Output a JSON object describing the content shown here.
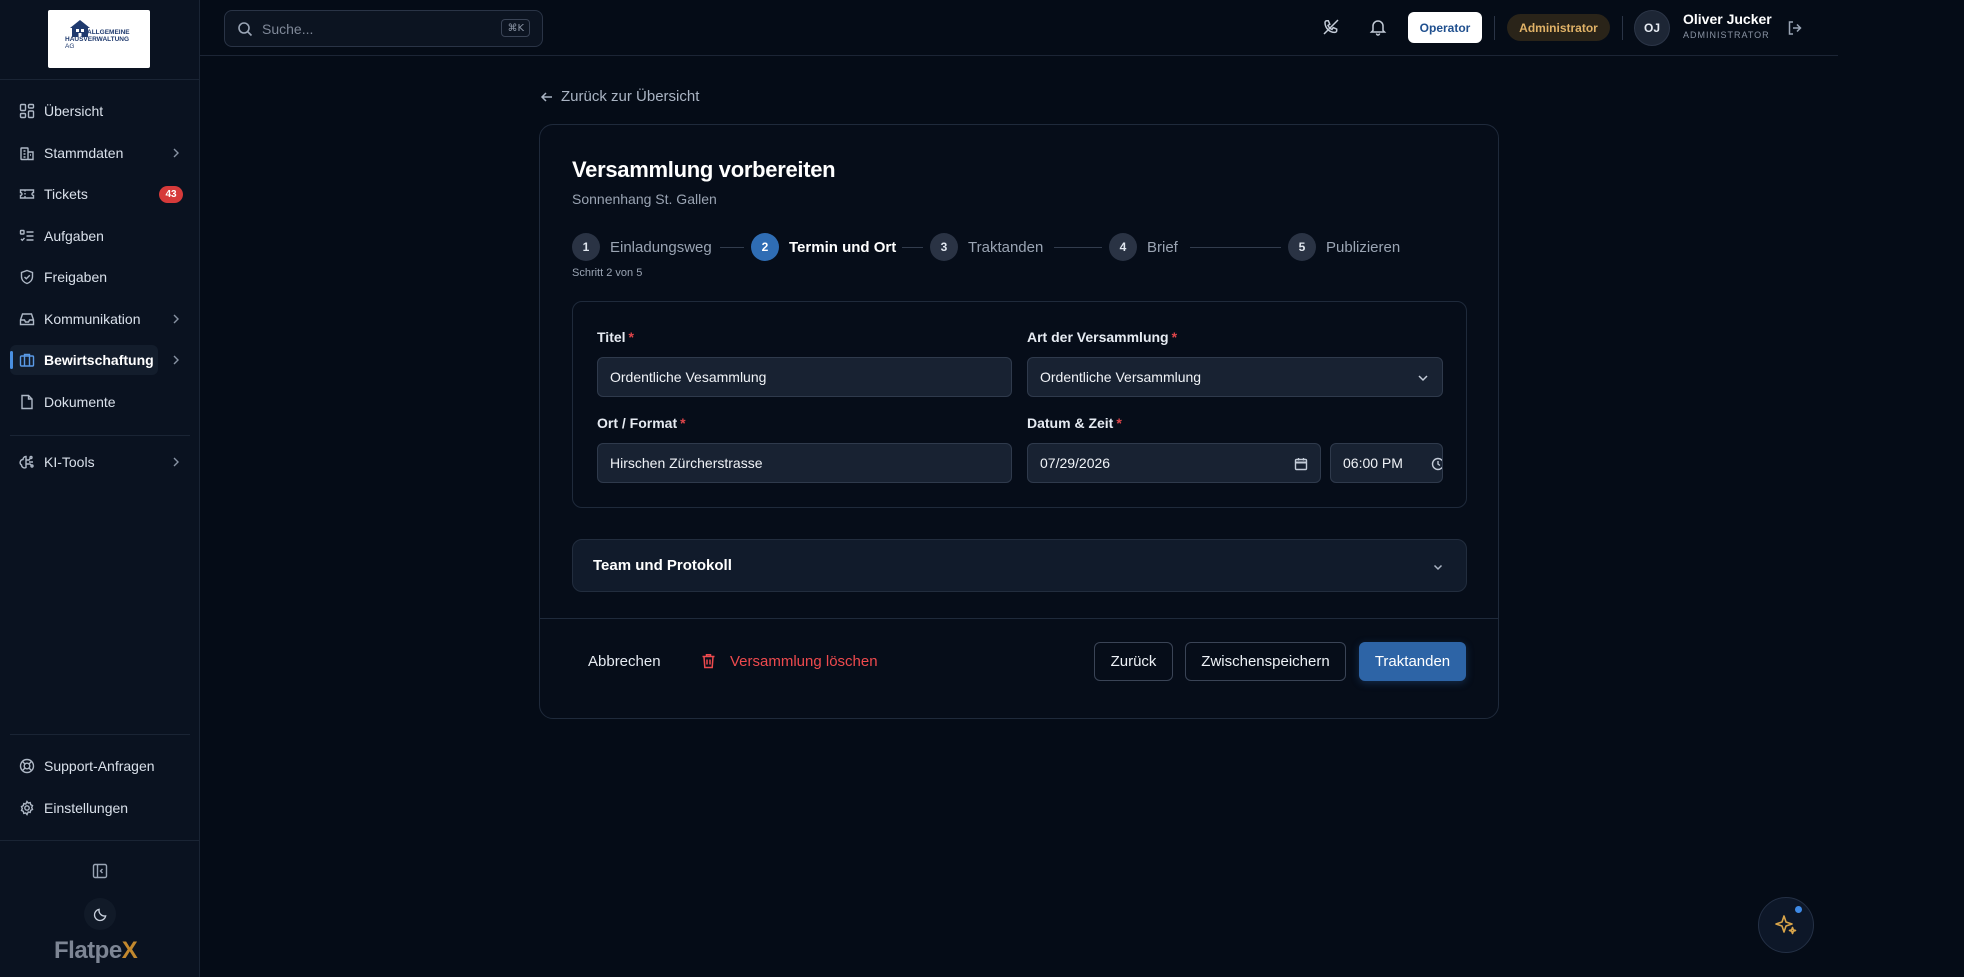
{
  "logo": {
    "line1": "ALLGEMEINE",
    "line2": "HAUSVERWALTUNG",
    "line3": "AG"
  },
  "sidebar": {
    "items": [
      {
        "label": "Übersicht",
        "icon": "dashboard-icon"
      },
      {
        "label": "Stammdaten",
        "icon": "building-icon"
      },
      {
        "label": "Tickets",
        "icon": "ticket-icon",
        "badge": "43"
      },
      {
        "label": "Aufgaben",
        "icon": "task-list-icon"
      },
      {
        "label": "Freigaben",
        "icon": "shield-check-icon"
      },
      {
        "label": "Kommunikation",
        "icon": "inbox-icon"
      },
      {
        "label": "Bewirtschaftung",
        "icon": "briefcase-icon",
        "active": true
      },
      {
        "label": "Dokumente",
        "icon": "document-icon"
      },
      {
        "label": "KI-Tools",
        "icon": "brain-icon"
      }
    ],
    "bottom_items": [
      {
        "label": "Support-Anfragen",
        "icon": "lifebuoy-icon"
      },
      {
        "label": "Einstellungen",
        "icon": "gear-icon"
      }
    ],
    "brand": {
      "main": "Flatpe",
      "accent": "X"
    }
  },
  "topbar": {
    "search_placeholder": "Suche...",
    "search_shortcut": "⌘K",
    "operator_label": "Operator",
    "role_badge": "Administrator",
    "user_initials": "OJ",
    "user_name": "Oliver Jucker",
    "user_role": "ADMINISTRATOR"
  },
  "page": {
    "back_label": "Zurück zur Übersicht",
    "title": "Versammlung vorbereiten",
    "subtitle": "Sonnenhang St. Gallen",
    "steps": [
      {
        "num": "1",
        "label": "Einladungsweg"
      },
      {
        "num": "2",
        "label": "Termin und Ort",
        "current": true
      },
      {
        "num": "3",
        "label": "Traktanden"
      },
      {
        "num": "4",
        "label": "Brief"
      },
      {
        "num": "5",
        "label": "Publizieren"
      }
    ],
    "step_counter": "Schritt 2 von 5",
    "form": {
      "title_label": "Titel",
      "title_value": "Ordentliche Vesammlung",
      "type_label": "Art der Versammlung",
      "type_value": "Ordentliche Versammlung",
      "location_label": "Ort / Format",
      "location_value": "Hirschen Zürcherstrasse",
      "datetime_label": "Datum & Zeit",
      "date_value": "07/29/2026",
      "time_value": "06:00 PM",
      "required_mark": "*"
    },
    "accordion_label": "Team und Protokoll",
    "actions": {
      "cancel": "Abbrechen",
      "delete": "Versammlung löschen",
      "back": "Zurück",
      "save_draft": "Zwischenspeichern",
      "next": "Traktanden"
    }
  },
  "colors": {
    "background": "#050c17",
    "sidebar": "#0a1220",
    "accent_blue": "#2d64a6",
    "danger": "#ee4a4e",
    "badge_red": "#d63a3a",
    "admin_gold": "#e0b267"
  }
}
